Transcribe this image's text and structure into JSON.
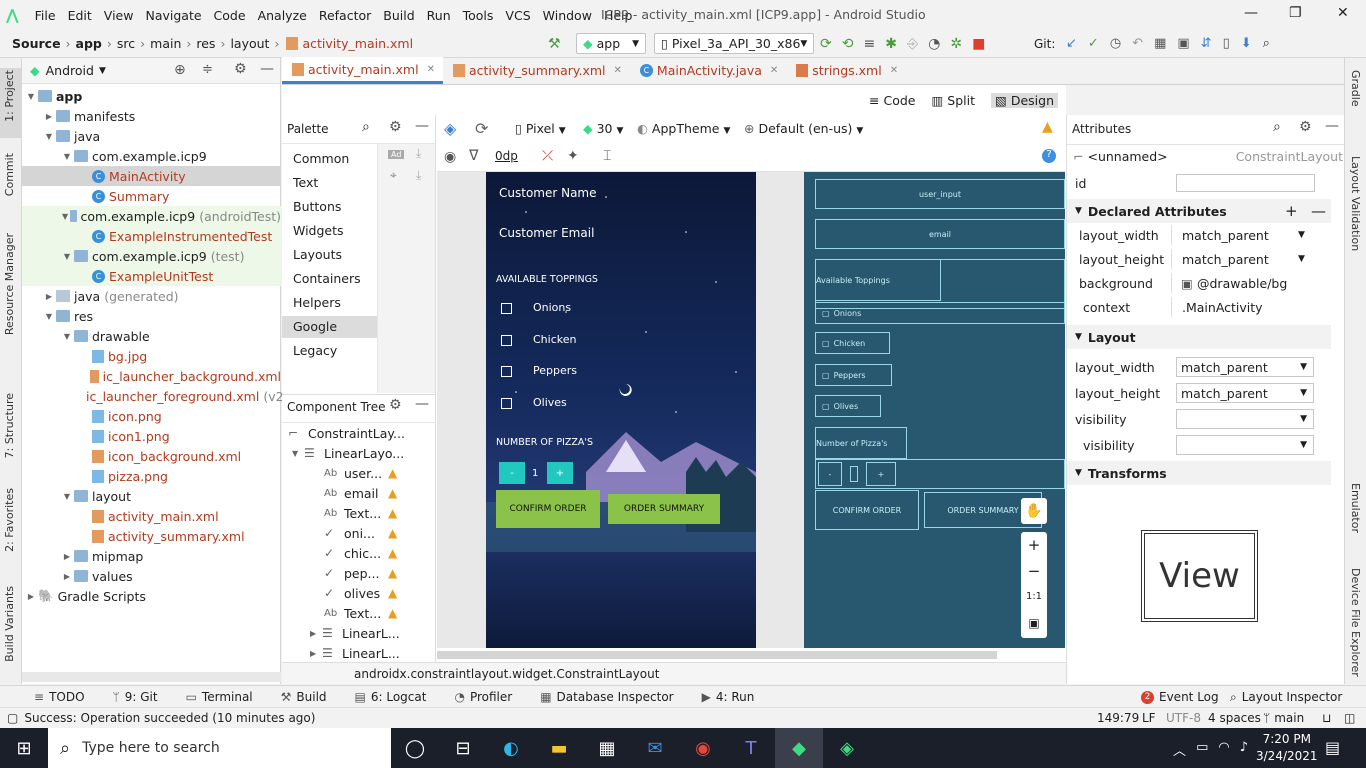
{
  "menubar": {
    "items": [
      "File",
      "Edit",
      "View",
      "Navigate",
      "Code",
      "Analyze",
      "Refactor",
      "Build",
      "Run",
      "Tools",
      "VCS",
      "Window",
      "Help"
    ],
    "title": "ICP9 - activity_main.xml [ICP9.app] - Android Studio",
    "minimize": "—",
    "restore": "❐",
    "close": "✕"
  },
  "navbar": {
    "crumbs": [
      "Source",
      "app",
      "src",
      "main",
      "res",
      "layout",
      "activity_main.xml"
    ],
    "run_config": "app",
    "device": "Pixel_3a_API_30_x86",
    "git_label": "Git:"
  },
  "left_strip": [
    "1: Project",
    "Commit",
    "Resource Manager",
    "7: Structure",
    "2: Favorites",
    "Build Variants"
  ],
  "right_strip": [
    "Gradle",
    "Layout Validation",
    "Emulator",
    "Device File Explorer"
  ],
  "project": {
    "view": "Android",
    "rows": [
      {
        "label": "app",
        "depth": 0,
        "expanded": "open",
        "icon": "folder",
        "bold": true
      },
      {
        "label": "manifests",
        "depth": 1,
        "expanded": "closed",
        "icon": "folder"
      },
      {
        "label": "java",
        "depth": 1,
        "expanded": "open",
        "icon": "folder"
      },
      {
        "label": "com.example.icp9",
        "depth": 2,
        "expanded": "open",
        "icon": "folder"
      },
      {
        "label": "MainActivity",
        "depth": 3,
        "icon": "class",
        "cls": "red",
        "selected": true
      },
      {
        "label": "Summary",
        "depth": 3,
        "icon": "class",
        "cls": "red"
      },
      {
        "label": "com.example.icp9",
        "suffix": "(androidTest)",
        "depth": 2,
        "expanded": "open",
        "icon": "folder",
        "bg": "#eef8e8"
      },
      {
        "label": "ExampleInstrumentedTest",
        "depth": 3,
        "icon": "class",
        "cls": "red",
        "bg": "#eef8e8"
      },
      {
        "label": "com.example.icp9",
        "suffix": "(test)",
        "depth": 2,
        "expanded": "open",
        "icon": "folder",
        "bg": "#eef8e8"
      },
      {
        "label": "ExampleUnitTest",
        "depth": 3,
        "icon": "class",
        "cls": "red",
        "bg": "#eef8e8"
      },
      {
        "label": "java",
        "suffix": "(generated)",
        "depth": 1,
        "expanded": "closed",
        "icon": "folderlt"
      },
      {
        "label": "res",
        "depth": 1,
        "expanded": "open",
        "icon": "folder"
      },
      {
        "label": "drawable",
        "depth": 2,
        "expanded": "open",
        "icon": "folder"
      },
      {
        "label": "bg.jpg",
        "depth": 3,
        "icon": "img",
        "cls": "red"
      },
      {
        "label": "ic_launcher_background.xml",
        "depth": 3,
        "icon": "xml",
        "cls": "red"
      },
      {
        "label": "ic_launcher_foreground.xml",
        "suffix": "(v2",
        "depth": 3,
        "icon": "xml",
        "cls": "red"
      },
      {
        "label": "icon.png",
        "depth": 3,
        "icon": "img",
        "cls": "red"
      },
      {
        "label": "icon1.png",
        "depth": 3,
        "icon": "img",
        "cls": "red"
      },
      {
        "label": "icon_background.xml",
        "depth": 3,
        "icon": "xml",
        "cls": "red"
      },
      {
        "label": "pizza.png",
        "depth": 3,
        "icon": "img",
        "cls": "red"
      },
      {
        "label": "layout",
        "depth": 2,
        "expanded": "open",
        "icon": "folder"
      },
      {
        "label": "activity_main.xml",
        "depth": 3,
        "icon": "xml",
        "cls": "red"
      },
      {
        "label": "activity_summary.xml",
        "depth": 3,
        "icon": "xml",
        "cls": "red"
      },
      {
        "label": "mipmap",
        "depth": 2,
        "expanded": "closed",
        "icon": "folder"
      },
      {
        "label": "values",
        "depth": 2,
        "expanded": "closed",
        "icon": "folder"
      },
      {
        "label": "Gradle Scripts",
        "depth": 0,
        "expanded": "closed",
        "icon": "gradle"
      }
    ]
  },
  "tabs": [
    {
      "label": "activity_main.xml",
      "active": true
    },
    {
      "label": "activity_summary.xml"
    },
    {
      "label": "MainActivity.java"
    },
    {
      "label": "strings.xml"
    }
  ],
  "view_modes": {
    "code": "Code",
    "split": "Split",
    "design": "Design"
  },
  "design_toolbar": {
    "device": "Pixel",
    "api": "30",
    "theme": "AppTheme",
    "locale": "Default (en-us)",
    "margin": "0dp"
  },
  "palette": {
    "title": "Palette",
    "categories": [
      "Common",
      "Text",
      "Buttons",
      "Widgets",
      "Layouts",
      "Containers",
      "Helpers",
      "Google",
      "Legacy"
    ],
    "selected": "Google"
  },
  "component_tree": {
    "title": "Component Tree",
    "rows": [
      {
        "label": "ConstraintLay...",
        "depth": 0,
        "warn": false
      },
      {
        "label": "LinearLayo...",
        "depth": 1,
        "warn": false,
        "expander": "open"
      },
      {
        "label": "user...",
        "depth": 2,
        "warn": true,
        "glyph": "Ab"
      },
      {
        "label": "email",
        "depth": 2,
        "warn": true,
        "glyph": "Ab"
      },
      {
        "label": "Text...",
        "depth": 2,
        "warn": true,
        "glyph": "Ab"
      },
      {
        "label": "oni...",
        "depth": 2,
        "warn": true,
        "glyph": "✓"
      },
      {
        "label": "chic...",
        "depth": 2,
        "warn": true,
        "glyph": "✓"
      },
      {
        "label": "pep...",
        "depth": 2,
        "warn": true,
        "glyph": "✓"
      },
      {
        "label": "olives",
        "depth": 2,
        "warn": true,
        "glyph": "✓"
      },
      {
        "label": "Text...",
        "depth": 2,
        "warn": true,
        "glyph": "Ab"
      },
      {
        "label": "LinearL...",
        "depth": 2,
        "warn": false,
        "expander": "closed"
      },
      {
        "label": "LinearL...",
        "depth": 2,
        "warn": false,
        "expander": "closed"
      }
    ]
  },
  "phone": {
    "customer_name": "Customer Name",
    "customer_email": "Customer Email",
    "toppings_title": "AVAILABLE TOPPINGS",
    "toppings": [
      "Onions",
      "Chicken",
      "Peppers",
      "Olives"
    ],
    "pizzas_title": "NUMBER OF PIZZA'S",
    "minus": "-",
    "qty": "1",
    "plus": "+",
    "confirm": "CONFIRM ORDER",
    "summary": "ORDER SUMMARY"
  },
  "blueprint": {
    "user": "user_input",
    "email": "email",
    "toppings": "Available Toppings",
    "onions": "Onions",
    "chicken": "Chicken",
    "peppers": "Peppers",
    "olives": "Olives",
    "pizzas": "Number of Pizza's",
    "minus": "-",
    "plus": "+",
    "confirm": "CONFIRM ORDER",
    "summary": "ORDER SUMMARY"
  },
  "zoom": {
    "in": "+",
    "out": "−",
    "one": "1:1"
  },
  "breadcrumb_bottom": "androidx.constraintlayout.widget.ConstraintLayout",
  "attributes": {
    "title": "Attributes",
    "component": "<unnamed>",
    "component_type": "ConstraintLayout",
    "id_label": "id",
    "id_value": "",
    "declared_title": "Declared Attributes",
    "declared": [
      {
        "name": "layout_width",
        "value": "match_parent"
      },
      {
        "name": "layout_height",
        "value": "match_parent"
      },
      {
        "name": "background",
        "value": "@drawable/bg"
      },
      {
        "name": "context",
        "value": ".MainActivity"
      }
    ],
    "layout_title": "Layout",
    "layout": [
      {
        "name": "layout_width",
        "value": "match_parent"
      },
      {
        "name": "layout_height",
        "value": "match_parent"
      },
      {
        "name": "visibility",
        "value": ""
      },
      {
        "name": "visibility",
        "value": ""
      }
    ],
    "transforms_title": "Transforms",
    "view_preview": "View"
  },
  "bottom_tools": [
    "TODO",
    "9: Git",
    "Terminal",
    "Build",
    "6: Logcat",
    "Profiler",
    "Database Inspector",
    "4: Run"
  ],
  "bottom_right": {
    "event_log": "Event Log",
    "event_count": "2",
    "layout_inspector": "Layout Inspector"
  },
  "status": {
    "message": "Success: Operation succeeded (10 minutes ago)",
    "position": "149:79",
    "line_sep": "LF",
    "encoding": "UTF-8",
    "indent": "4 spaces",
    "branch": "main"
  },
  "taskbar": {
    "search_placeholder": "Type here to search",
    "time": "7:20 PM",
    "date": "3/24/2021"
  }
}
